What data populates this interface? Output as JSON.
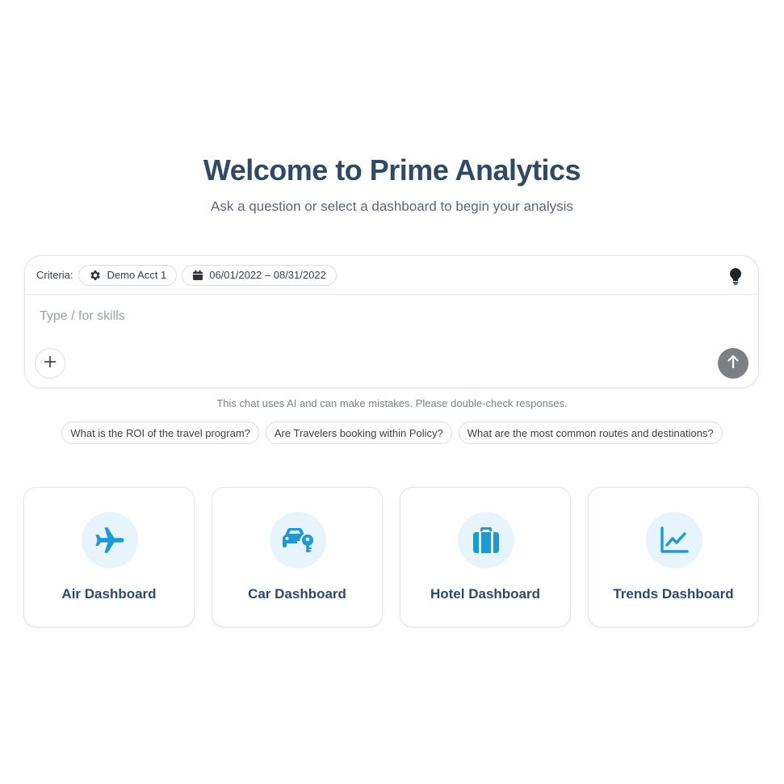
{
  "header": {
    "title": "Welcome to Prime Analytics",
    "subtitle": "Ask a question or select a dashboard to begin your analysis"
  },
  "chat": {
    "criteria_label": "Criteria:",
    "account_chip": "Demo Acct 1",
    "date_chip": "06/01/2022 – 08/31/2022",
    "input_placeholder": "Type / for skills",
    "input_value": ""
  },
  "disclaimer": "This chat uses AI and can make mistakes. Please double-check responses.",
  "suggestions": [
    "What is the ROI of the travel program?",
    "Are Travelers booking within Policy?",
    "What are the most common routes and destinations?"
  ],
  "dashboards": [
    {
      "label": "Air Dashboard",
      "icon": "airplane-icon"
    },
    {
      "label": "Car Dashboard",
      "icon": "car-key-icon"
    },
    {
      "label": "Hotel Dashboard",
      "icon": "luggage-icon"
    },
    {
      "label": "Trends Dashboard",
      "icon": "trend-chart-icon"
    }
  ],
  "colors": {
    "accent": "#1a9ad6",
    "icon_bg": "#e8f4fb",
    "title": "#2f4a66",
    "send_button": "#7c7f84"
  }
}
